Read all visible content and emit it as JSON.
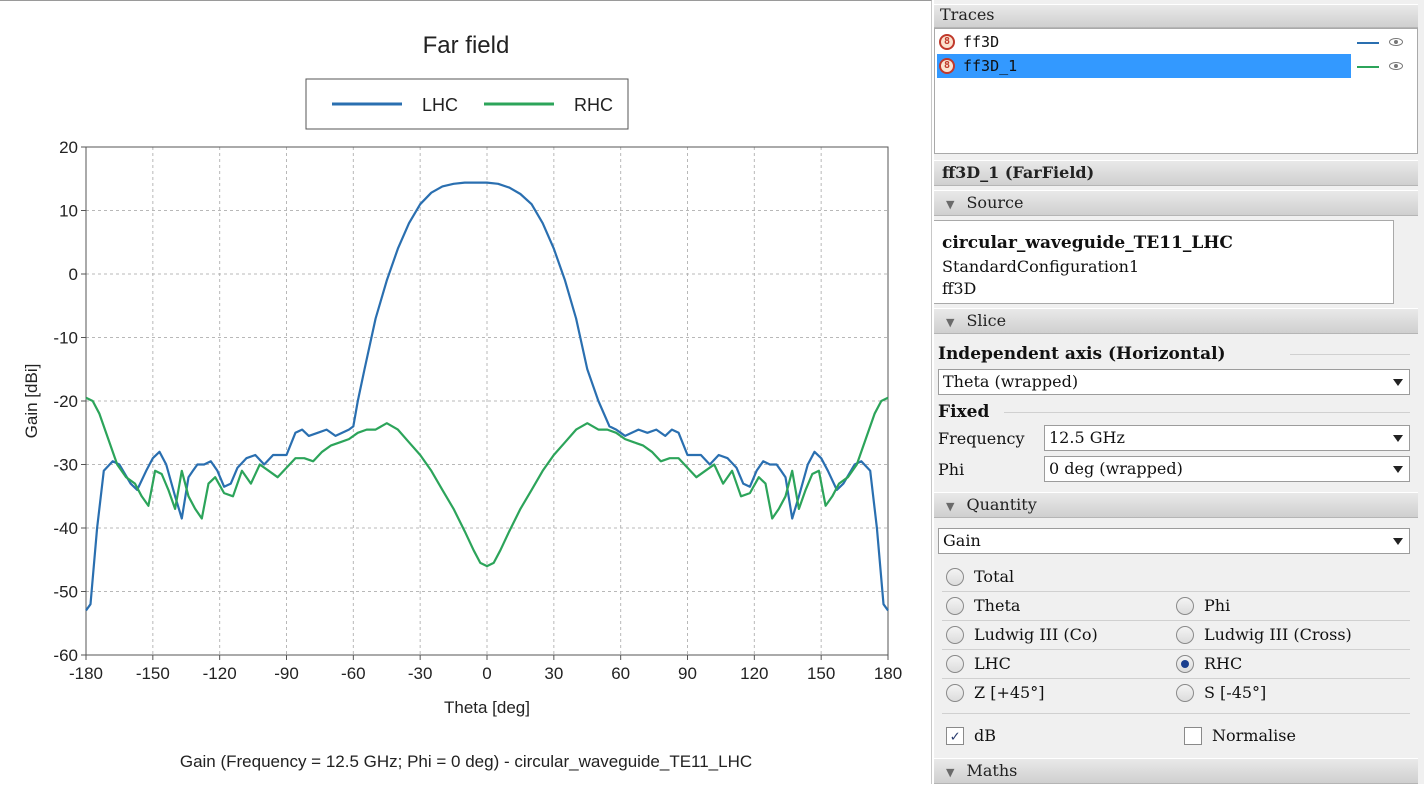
{
  "chart_data": {
    "type": "line",
    "title": "Far field",
    "xlabel": "Theta [deg]",
    "ylabel": "Gain [dBi]",
    "caption": "Gain (Frequency = 12.5 GHz; Phi = 0 deg) - circular_waveguide_TE11_LHC",
    "xlim": [
      -180,
      180
    ],
    "ylim": [
      -60,
      20
    ],
    "xticks": [
      -180,
      -150,
      -120,
      -90,
      -60,
      -30,
      0,
      30,
      60,
      90,
      120,
      150,
      180
    ],
    "yticks": [
      20,
      10,
      0,
      -10,
      -20,
      -30,
      -40,
      -50,
      -60
    ],
    "grid": true,
    "legend_position": "top-center",
    "series": [
      {
        "name": "LHC",
        "color": "#2a6fb0",
        "x": [
          -180,
          -178,
          -175,
          -172,
          -168,
          -165,
          -160,
          -157,
          -153,
          -150,
          -147,
          -144,
          -140,
          -137,
          -134,
          -132,
          -130,
          -127,
          -124,
          -121,
          -118,
          -115,
          -112,
          -108,
          -104,
          -100,
          -96,
          -93,
          -90,
          -86,
          -83,
          -80,
          -76,
          -72,
          -68,
          -65,
          -62,
          -60,
          -58,
          -55,
          -50,
          -45,
          -40,
          -35,
          -30,
          -25,
          -20,
          -15,
          -10,
          -5,
          0,
          5,
          10,
          15,
          20,
          25,
          30,
          35,
          40,
          45,
          50,
          55,
          58,
          60,
          62,
          65,
          68,
          72,
          76,
          80,
          83,
          86,
          90,
          93,
          96,
          100,
          104,
          108,
          112,
          115,
          118,
          121,
          124,
          127,
          130,
          132,
          134,
          137,
          140,
          144,
          147,
          150,
          153,
          157,
          160,
          165,
          168,
          172,
          175,
          178,
          180
        ],
        "y": [
          -53,
          -52,
          -40,
          -31,
          -29.5,
          -30,
          -33,
          -34,
          -31,
          -29,
          -28,
          -30,
          -35,
          -38.5,
          -32,
          -31,
          -30,
          -30,
          -29.5,
          -31,
          -33.5,
          -33,
          -30.5,
          -29,
          -28.5,
          -30,
          -28.5,
          -28.5,
          -28.5,
          -25,
          -24.5,
          -25.5,
          -25,
          -24.5,
          -25.5,
          -25,
          -24.5,
          -24,
          -20,
          -15,
          -7,
          -1,
          4,
          8,
          11,
          12.8,
          13.8,
          14.2,
          14.4,
          14.4,
          14.4,
          14.2,
          13.6,
          12.6,
          11,
          8,
          4,
          -1,
          -7,
          -15,
          -20,
          -24,
          -24.5,
          -25,
          -25.5,
          -25,
          -24.5,
          -25,
          -24.5,
          -25.5,
          -24.5,
          -25,
          -28.5,
          -28.5,
          -28.5,
          -30,
          -28.5,
          -29,
          -30.5,
          -33,
          -33.5,
          -31,
          -29.5,
          -30,
          -30,
          -31,
          -32,
          -38.5,
          -35,
          -30,
          -28,
          -29,
          -31,
          -34,
          -33,
          -30,
          -29.5,
          -31,
          -40,
          -52,
          -53
        ]
      },
      {
        "name": "RHC",
        "color": "#2ca45a",
        "x": [
          -180,
          -177,
          -174,
          -170,
          -166,
          -162,
          -158,
          -155,
          -152,
          -149,
          -146,
          -143,
          -140,
          -137,
          -134,
          -131,
          -128,
          -125,
          -122,
          -118,
          -114,
          -110,
          -106,
          -102,
          -98,
          -94,
          -90,
          -86,
          -82,
          -78,
          -74,
          -70,
          -66,
          -62,
          -58,
          -54,
          -50,
          -45,
          -40,
          -35,
          -30,
          -25,
          -20,
          -15,
          -10,
          -6,
          -3,
          0,
          3,
          6,
          10,
          15,
          20,
          25,
          30,
          35,
          40,
          45,
          50,
          54,
          58,
          62,
          66,
          70,
          74,
          78,
          82,
          86,
          90,
          94,
          98,
          102,
          106,
          110,
          114,
          118,
          122,
          125,
          128,
          131,
          134,
          137,
          140,
          143,
          146,
          149,
          152,
          155,
          158,
          162,
          166,
          170,
          174,
          177,
          180
        ],
        "y": [
          -19.5,
          -20,
          -22,
          -26,
          -30,
          -32,
          -33,
          -35,
          -36.5,
          -31,
          -31.5,
          -34,
          -37,
          -31,
          -35,
          -37,
          -38.5,
          -33,
          -32,
          -34.5,
          -35,
          -31,
          -33,
          -30,
          -31,
          -32,
          -30.5,
          -29,
          -29,
          -29.5,
          -28,
          -27,
          -26.5,
          -26,
          -25,
          -24.5,
          -24.5,
          -23.5,
          -24.5,
          -26.5,
          -28.5,
          -31,
          -34,
          -37,
          -40.5,
          -43.5,
          -45.5,
          -46,
          -45.5,
          -43.5,
          -40.5,
          -37,
          -34,
          -31,
          -28.5,
          -26.5,
          -24.5,
          -23.5,
          -24.5,
          -24.5,
          -25,
          -26,
          -26.5,
          -27,
          -28,
          -29.5,
          -29,
          -29,
          -30.5,
          -32,
          -31,
          -30,
          -33,
          -31,
          -35,
          -34.5,
          -32,
          -33,
          -38.5,
          -37,
          -35,
          -31,
          -37,
          -34,
          -31.5,
          -31,
          -36.5,
          -35,
          -33,
          -32,
          -30,
          -26,
          -22,
          -20,
          -19.5
        ]
      }
    ]
  },
  "traces_panel": {
    "header": "Traces",
    "items": [
      {
        "label": "ff3D",
        "line_color": "#2a6fb0",
        "selected": false
      },
      {
        "label": "ff3D_1",
        "line_color": "#2ca45a",
        "selected": true
      }
    ]
  },
  "properties": {
    "title": "ff3D_1 (FarField)",
    "source": {
      "header": "Source",
      "lines": [
        "circular_waveguide_TE11_LHC",
        "StandardConfiguration1",
        "ff3D"
      ]
    },
    "slice": {
      "header": "Slice",
      "independent_axis_label": "Independent axis (Horizontal)",
      "independent_axis_value": "Theta (wrapped)",
      "fixed_label": "Fixed",
      "frequency_label": "Frequency",
      "frequency_value": "12.5 GHz",
      "phi_label": "Phi",
      "phi_value": "0 deg (wrapped)"
    },
    "quantity": {
      "header": "Quantity",
      "value": "Gain",
      "options": {
        "total": "Total",
        "theta": "Theta",
        "phi": "Phi",
        "ludwig_co": "Ludwig III (Co)",
        "ludwig_cross": "Ludwig III (Cross)",
        "lhc": "LHC",
        "rhc": "RHC",
        "z45": "Z [+45°]",
        "s45": "S [-45°]"
      },
      "selected": "rhc",
      "db_label": "dB",
      "db_checked": true,
      "normalise_label": "Normalise",
      "normalise_checked": false
    },
    "maths_header": "Maths"
  }
}
